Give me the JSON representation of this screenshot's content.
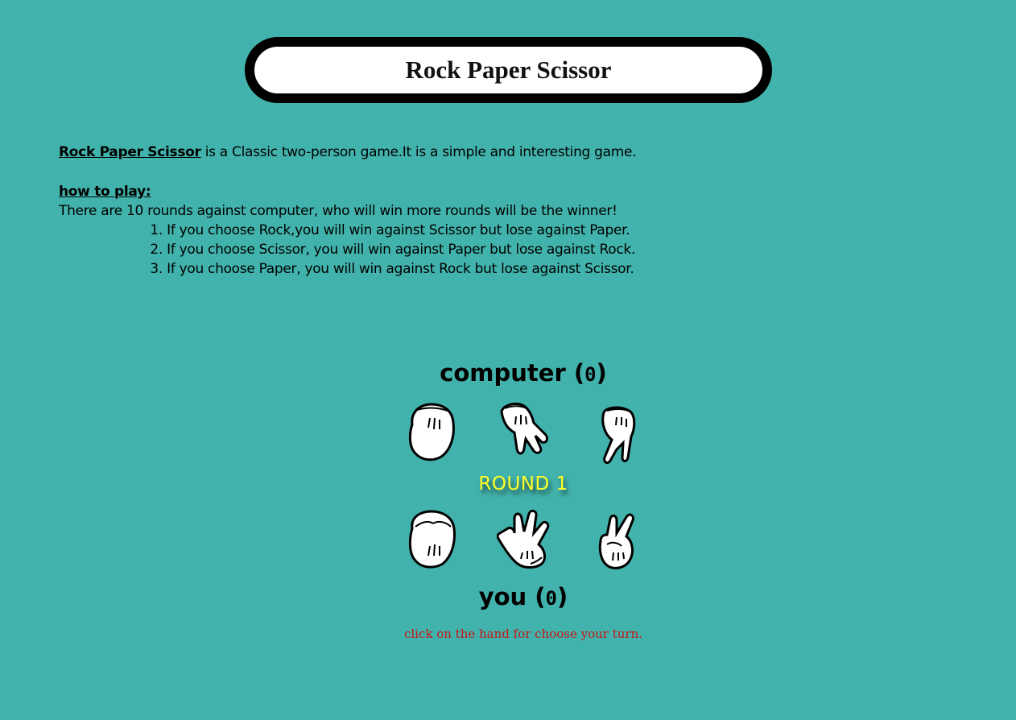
{
  "header": {
    "title": "Rock Paper Scissor"
  },
  "intro": {
    "game_name": "Rock Paper Scissor",
    "description": " is a Classic two-person game.It is a simple and interesting game."
  },
  "how_to_play": {
    "title": "how to play:",
    "summary": "There are 10 rounds against computer, who will win more rounds will be the winner!",
    "rules": [
      {
        "num": "1.",
        "text": "If you choose Rock,you will win against Scissor but lose against Paper."
      },
      {
        "num": "2.",
        "text": "If you choose Scissor, you will win against Paper but lose against Rock."
      },
      {
        "num": "3.",
        "text": "If you choose Paper, you will win against Rock but lose against Scissor."
      }
    ]
  },
  "computer": {
    "label": "computer (",
    "score": "0",
    "suffix": ")",
    "hands": [
      "rock-hand-icon",
      "paper-hand-icon",
      "scissor-hand-icon"
    ]
  },
  "round": {
    "label": "ROUND 1"
  },
  "player": {
    "label": "you (",
    "score": "0",
    "suffix": ")",
    "hands": [
      "rock-hand-icon",
      "paper-hand-icon",
      "scissor-hand-icon"
    ]
  },
  "hint": "click on the hand for choose your turn.",
  "colors": {
    "background": "#42b3ac",
    "round_text": "#ffff25",
    "hint_text": "#c61414"
  }
}
